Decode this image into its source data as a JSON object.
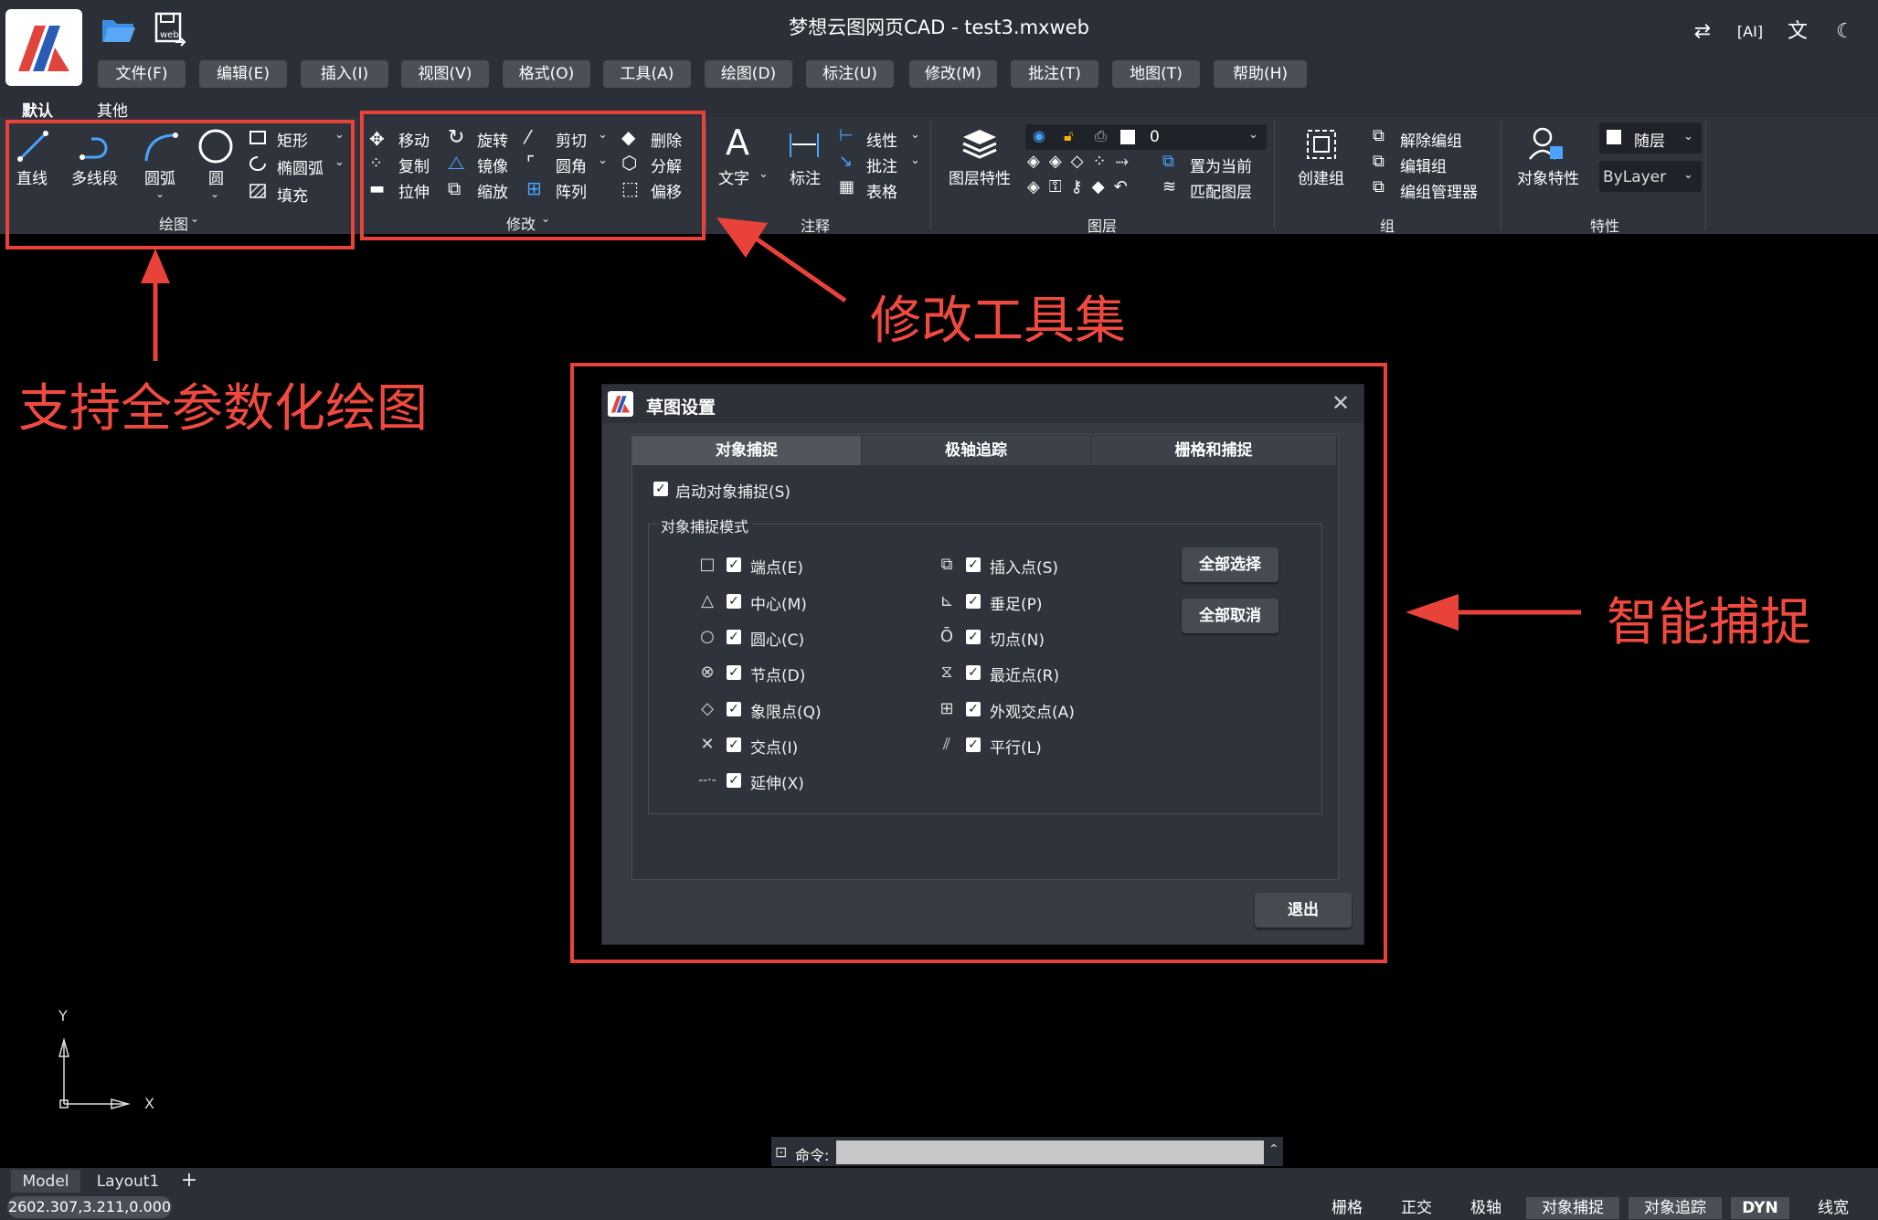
{
  "window": {
    "title": "梦想云图网页CAD - test3.mxweb",
    "tooltips": []
  },
  "menu": [
    "文件(F)",
    "编辑(E)",
    "插入(I)",
    "视图(V)",
    "格式(O)",
    "工具(A)",
    "绘图(D)",
    "标注(U)",
    "修改(M)",
    "批注(T)",
    "地图(T)",
    "帮助(H)"
  ],
  "ribbon_tabs": [
    "默认",
    "其他"
  ],
  "ribbon": {
    "draw": {
      "line": "直线",
      "polyline": "多线段",
      "arc": "圆弧",
      "circle": "圆",
      "rect": "矩形",
      "ellipse_arc": "椭圆弧",
      "hatch": "填充",
      "group": "绘图"
    },
    "modify": {
      "move": "移动",
      "rotate": "旋转",
      "trim": "剪切",
      "erase": "删除",
      "copy": "复制",
      "mirror": "镜像",
      "fillet": "圆角",
      "explode": "分解",
      "stretch": "拉伸",
      "scale": "缩放",
      "array": "阵列",
      "offset": "偏移",
      "group": "修改"
    },
    "annotate": {
      "text": "文字",
      "dim": "标注",
      "linear": "线性",
      "leader": "批注",
      "table": "表格",
      "group": "注释"
    },
    "layer": {
      "props": "图层特性",
      "current": "0",
      "set_current": "置为当前",
      "match": "匹配图层",
      "group": "图层"
    },
    "groups": {
      "create": "创建组",
      "ungroup": "解除编组",
      "edit": "编辑组",
      "manager": "编组管理器",
      "group": "组"
    },
    "props": {
      "object": "对象特性",
      "color": "随层",
      "linetype": "ByLayer",
      "group": "特性"
    }
  },
  "annotations": {
    "draw": "支持全参数化绘图",
    "modify": "修改工具集",
    "snap": "智能捕捉"
  },
  "dialog": {
    "title": "草图设置",
    "tabs": [
      "对象捕捉",
      "极轴追踪",
      "栅格和捕捉"
    ],
    "enable": "启动对象捕捉(S)",
    "section": "对象捕捉模式",
    "left_modes": [
      "端点(E)",
      "中心(M)",
      "圆心(C)",
      "节点(D)",
      "象限点(Q)",
      "交点(I)",
      "延伸(X)"
    ],
    "right_modes": [
      "插入点(S)",
      "垂足(P)",
      "切点(N)",
      "最近点(R)",
      "外观交点(A)",
      "平行(L)"
    ],
    "select_all": "全部选择",
    "clear_all": "全部取消",
    "exit": "退出"
  },
  "axis": {
    "y": "Y",
    "x": "X"
  },
  "command": {
    "label": "命令:",
    "value": ""
  },
  "layout_tabs": [
    "Model",
    "Layout1",
    "+"
  ],
  "coords": "2602.307,3.211,0.000",
  "status_items": [
    "栅格",
    "正交",
    "极轴",
    "对象捕捉",
    "对象追踪",
    "DYN",
    "线宽"
  ],
  "colors": {
    "accent": "#e8423a",
    "bg": "#000000",
    "panel": "#2f343c"
  }
}
